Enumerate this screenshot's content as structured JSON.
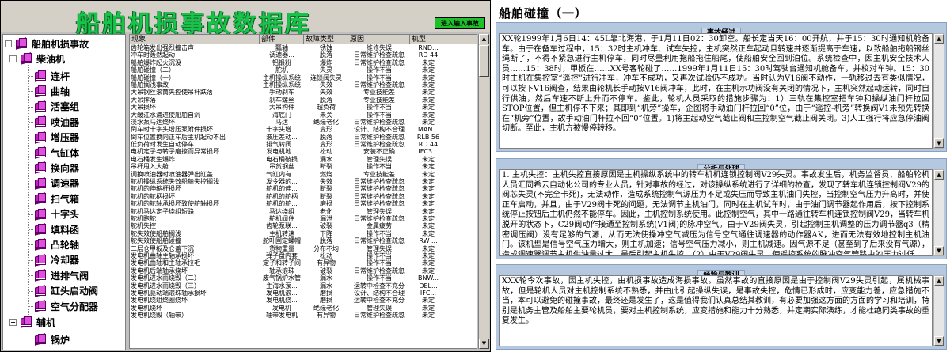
{
  "app": {
    "title": "船舶机损事故数据库",
    "enter_button": "进入输入事故"
  },
  "tree": {
    "root": "船舶机损事故",
    "group1": "柴油机",
    "items": [
      "连杆",
      "曲轴",
      "活塞组",
      "喷油器",
      "增压器",
      "气缸体",
      "换向器",
      "调速器",
      "扫气箱",
      "十字头",
      "填料函",
      "凸轮轴",
      "冷却器",
      "进排气阀",
      "缸头启动阀",
      "空气分配器"
    ],
    "group2": "辅机",
    "group2_items": [
      "锅炉"
    ]
  },
  "grid": {
    "columns": [
      "现象",
      "部件",
      "故障类型",
      "原因",
      "机型"
    ],
    "rows": [
      [
        "齿轮箱发出强烈撞击声",
        "瓢轴",
        "锈蚀",
        "维修失误",
        "RND..."
      ],
      [
        "冲车时轰然起动",
        "调速器...",
        "脱落",
        "日常维护检查疏忽",
        "RD 44"
      ],
      [
        "船舶爆炸起火沉没",
        "铝锻粉",
        "爆炸",
        "日常维护检查疏忽",
        "未定"
      ],
      [
        "船舶碰撞（二）",
        "舵机",
        "失灵",
        "操作不当",
        "未定"
      ],
      [
        "船舶碰撞（一）",
        "主机操纵系统",
        "连锁阀失灵",
        "操作不当",
        "未定"
      ],
      [
        "船舶搁浅事故",
        "主机操纵系统",
        "失效",
        "日常维护检查疏忽",
        "未定"
      ],
      [
        "大吊钢丝滚筒失控使吊杆跌落",
        "手动刹车",
        "失效",
        "专业技能差",
        "未定"
      ],
      [
        "大吊摔落",
        "刹车螺丝",
        "脱落",
        "专业技能差",
        "未定"
      ],
      [
        "大吊损坏",
        "大吊构件",
        "超负荷",
        "操作不当",
        "未定"
      ],
      [
        "大缓江水浦进使船舶自沉",
        "海底门",
        "未关",
        "操作不当",
        "未定"
      ],
      [
        "淡水泵马达烧坏",
        "马达",
        "绝缘老化",
        "日常维护检查疏忽",
        "未定"
      ],
      [
        "倒车时十字头增压泵附件损坏",
        "十字头增...",
        "变形",
        "设计、结构不合理",
        "MAN..."
      ],
      [
        "倒车位置换向正车后主机起动不出",
        "液压差动...",
        "脱落",
        "日常维护检查疏忽",
        "RLB 56"
      ],
      [
        "低负荷时发生自动停车",
        "排气转阀...",
        "变形",
        "日常维护检查疏忽",
        "RD 44"
      ],
      [
        "电机定子与转子磨擦而异常损坏",
        "发电机地...",
        "松动",
        "安装不正确",
        "IFC3..."
      ],
      [
        "电石桶发生爆炸",
        "电石桶破损",
        "漏水",
        "管理失误",
        "未定"
      ],
      [
        "吊杆甩入大舱",
        "吊货钢丝",
        "断裂",
        "操作不当",
        "未定"
      ],
      [
        "调换喷油器时喷油器弹出缸盖",
        "气缸内有...",
        "燃烧",
        "专业技能差",
        "未定"
      ],
      [
        "舵机操纵系统失效船舶失控搁浅",
        "发令器的...",
        "失效",
        "日常维护检查疏忽",
        "未定"
      ],
      [
        "舵机的伸缩杆损坏",
        "舵机的伸...",
        "断裂",
        "日常维护检查疏忽",
        "未定"
      ],
      [
        "舵机的舵柄损坏",
        "舵机的舵柄",
        "断裂",
        "日常维护检查疏忽",
        "未定"
      ],
      [
        "舵机的舵轴承损坏致使舵轴损坏",
        "舵机的舵...",
        "磨损",
        "日常维护检查疏忽",
        "未定"
      ],
      [
        "舵机马达定子绕组短路",
        "马达绕组",
        "老化",
        "管理失误",
        "未定"
      ],
      [
        "舵机跑舵",
        "舵机阀件",
        "漏泄",
        "日常维护检查疏忽",
        "未定"
      ],
      [
        "舵机失控",
        "齿轮泵联...",
        "破裂",
        "金属疲劳",
        "未定"
      ],
      [
        "舵失效使船舶搁浅",
        "主机转速",
        "下降",
        "操作不当",
        "未定"
      ],
      [
        "舵失效使船舶碰撞",
        "舵叶固定螺帽",
        "脱落",
        "日常维护检查疏忽",
        "RW ..."
      ],
      [
        "二层仓甲板及仓盖下沉",
        "货物重量",
        "分布不均",
        "管理失误",
        "未定"
      ],
      [
        "发电机曲轴主轴承损坏",
        "弹子盘内套",
        "松动",
        "操作不当",
        "未定"
      ],
      [
        "发电机曲轴和主轴承拉毛",
        "定子和转子间",
        "有异物",
        "操作不当",
        "未定"
      ],
      [
        "发电机后端轴承烧坏",
        "轴承滚珠",
        "破裂",
        "日常维护检查疏忽",
        "未定"
      ],
      [
        "发电机进水而烧毁（二）",
        "废气锅炉水管",
        "漏水",
        "操作不当",
        "BNW..."
      ],
      [
        "发电机进水而烧毁（三）",
        "主海水泵...",
        "漏水",
        "运转中检查不充分",
        "DEL..."
      ],
      [
        "发电机驱动端滚珠轴承损坏",
        "发电机滚...",
        "磨损",
        "设计、结构不合理",
        "IFC..."
      ],
      [
        "发电机烧组烧圈烧坏",
        "发电机烧...",
        "磨损",
        "运转中检查不充分",
        "未定"
      ],
      [
        "发电机烧坏",
        "发电机",
        "绝缘老化",
        "管理失误",
        "未定"
      ],
      [
        "发电机烧毁（轴带）",
        "轴带发电机",
        "有异物",
        "日常维护检查疏忽",
        "未定"
      ]
    ]
  },
  "detail": {
    "title": "船舶碰撞（一）",
    "sec1_title": "事故经过",
    "sec1_text": "XX轮1999年1月6日14：45L靠北海港，于1月11日02：30卸空。船长定当天16：00开航，并于15：30时通知机舱备车。由于在备车过程中，15：32时主机冲车、试车失控，主机突然正车起动且转速并逐渐提高于车速，以致船舶拖船钢丝绳断了，不得不紧急进行主机停车，同时尽量利用拖船拖住船尾，使船舶安全回到泊位。系统检查中，因主机安全技术人员……15：38时，甲板在……XX号客轮碰了……1999年1月11日15：30时驾驶台通知机舱备车，并校对车钟。15：30时主机在集控室“遥控”进行冲车，冲车不成功，又再次试验仍不成功。当时认为V16阀不动作，一轨移过去有类似情况，可以按下V16阀查，结果由轮机长手动按V16阀冲车，此时，在主机示功阀没有关闭的情况下，主机突然起动运转，同时自行供油，然后车速不断上升而不停车。鉴此，轮机人员采取的措施步骤为：1）三轨在集控室把车钟和操纵油门杆拉回STOP位置，但主机停不下来；其即到“机旁”操车，企图将手动油门杆拉回“0”位，由于“遥控-机旁”转换阀V1未预先转换在“机旁”位置，故手动油门杆拉不回“0”位置。1)将主起动空气截止阀和主控制空气截止阀关闭。3)人工强行将应急停油阀切断。至此，主机方被慢停转移。",
    "sec2_title": "分析与处理",
    "sec2_text": "1. 主机失控：主机失控直接原因是主机操纵系统中的转车机机连锁控制阀V29失灵。事故发生后，机务监督员、船舶轮机人员汇同希云自动化公司的专业人员，针对事故的经过，对该操纵系统进行了详细的检查，发现了转车机连锁控制阀V29的阀芯失灵(不完全卡死)，无法动作，造成系统控制气源压力不足或失压而导致主机油门失控，当控制空气压力升高时，并使正车启动，并且，由于V29阀卡死的问题，无法调节主机油门，同时在主机试车时，由于油门调节器起作用后，按下控制系统停止按钮后主机仍然不能停车。因此，主机控制系统使用。此控制空气，其中一路通往转车机连锁控制阀V29，当转车机脱开的状态下，C29阀动作接通至控制系统(V1阀)的脉冲空气。由于V29阀失灵，引起控制主机调整的压力调节器q3（精密调压阀）没有足够的气源，从而无法使操冲空气减压为信号空气通往调速器的动作器AK，进而无法有效地控制主机油门。该机型是信号空气压力增大，则主机加速；信号空气压力减小，则主机减速。因气源不足（甚至到了后来没有气源），造成调速器调节主机供油量过大，最后引起主机失控。（2）由于V29阀失灵，使遥控系统的脉冲空气管路中的压力过低。",
    "sec3_title": "经验与教训",
    "sec3_text": "XXX轮今次事故，因主机失控，由机损事故造成海损事故。虽然事故的直接原因是由于控制阀V29失灵引起，属机械事故，但是轮机人员对主机控制系统不熟悉，并由此引起操纵失误，是事故失控，危情已形成时，应变能力差，应急措施不当，本可以避免的碰撞事故，最终还是发生了，这是值得我们认真总结其教训，有必要加强这方面的方面的学习和培训，特别是机务主管及船舶主要轮机员，要对主机控制系统，应变措施和能力十分熟悉，并定期实际演练，才能杜绝同类事故的重复发生。"
  }
}
